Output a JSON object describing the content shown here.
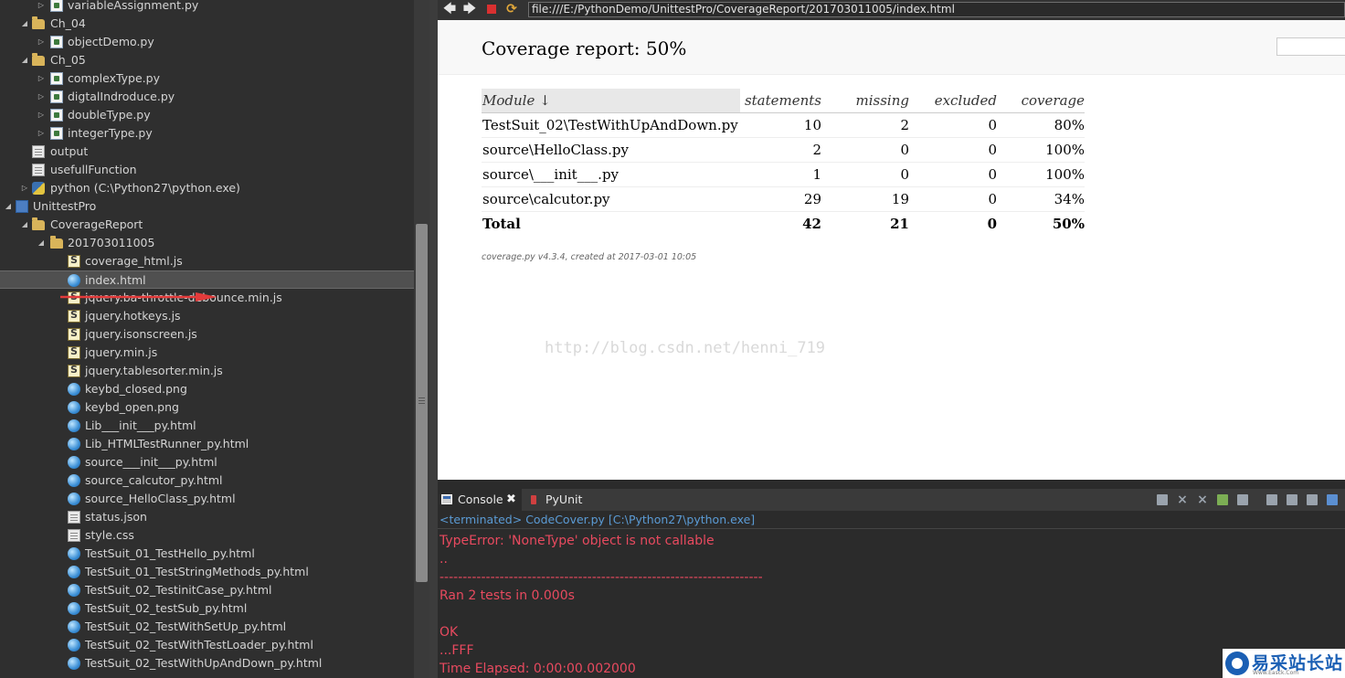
{
  "tree": [
    {
      "label": "variableAssignment.py",
      "icon": "py",
      "depth": 3,
      "arrow": "collapsed"
    },
    {
      "label": "Ch_04",
      "icon": "folder",
      "depth": 2,
      "arrow": "expanded"
    },
    {
      "label": "objectDemo.py",
      "icon": "py",
      "depth": 3,
      "arrow": "collapsed"
    },
    {
      "label": "Ch_05",
      "icon": "folder",
      "depth": 2,
      "arrow": "expanded"
    },
    {
      "label": "complexType.py",
      "icon": "py",
      "depth": 3,
      "arrow": "collapsed"
    },
    {
      "label": "digtalIndroduce.py",
      "icon": "py",
      "depth": 3,
      "arrow": "collapsed"
    },
    {
      "label": "doubleType.py",
      "icon": "py",
      "depth": 3,
      "arrow": "collapsed"
    },
    {
      "label": "integerType.py",
      "icon": "py",
      "depth": 3,
      "arrow": "collapsed"
    },
    {
      "label": "output",
      "icon": "file",
      "depth": 2,
      "arrow": "none"
    },
    {
      "label": "usefullFunction",
      "icon": "file",
      "depth": 2,
      "arrow": "none"
    },
    {
      "label": "python  (C:\\Python27\\python.exe)",
      "icon": "python",
      "depth": 2,
      "arrow": "collapsed"
    },
    {
      "label": "UnittestPro",
      "icon": "project",
      "depth": 1,
      "arrow": "expanded"
    },
    {
      "label": "CoverageReport",
      "icon": "folder",
      "depth": 2,
      "arrow": "expanded"
    },
    {
      "label": "201703011005",
      "icon": "folder",
      "depth": 3,
      "arrow": "expanded"
    },
    {
      "label": "coverage_html.js",
      "icon": "js",
      "depth": 4,
      "arrow": "none"
    },
    {
      "label": "index.html",
      "icon": "html",
      "depth": 4,
      "arrow": "none",
      "selected": true
    },
    {
      "label": "jquery.ba-throttle-debounce.min.js",
      "icon": "js",
      "depth": 4,
      "arrow": "none"
    },
    {
      "label": "jquery.hotkeys.js",
      "icon": "js",
      "depth": 4,
      "arrow": "none"
    },
    {
      "label": "jquery.isonscreen.js",
      "icon": "js",
      "depth": 4,
      "arrow": "none"
    },
    {
      "label": "jquery.min.js",
      "icon": "js",
      "depth": 4,
      "arrow": "none"
    },
    {
      "label": "jquery.tablesorter.min.js",
      "icon": "js",
      "depth": 4,
      "arrow": "none"
    },
    {
      "label": "keybd_closed.png",
      "icon": "html",
      "depth": 4,
      "arrow": "none"
    },
    {
      "label": "keybd_open.png",
      "icon": "html",
      "depth": 4,
      "arrow": "none"
    },
    {
      "label": "Lib___init___py.html",
      "icon": "html",
      "depth": 4,
      "arrow": "none"
    },
    {
      "label": "Lib_HTMLTestRunner_py.html",
      "icon": "html",
      "depth": 4,
      "arrow": "none"
    },
    {
      "label": "source___init___py.html",
      "icon": "html",
      "depth": 4,
      "arrow": "none"
    },
    {
      "label": "source_calcutor_py.html",
      "icon": "html",
      "depth": 4,
      "arrow": "none"
    },
    {
      "label": "source_HelloClass_py.html",
      "icon": "html",
      "depth": 4,
      "arrow": "none"
    },
    {
      "label": "status.json",
      "icon": "file",
      "depth": 4,
      "arrow": "none"
    },
    {
      "label": "style.css",
      "icon": "file",
      "depth": 4,
      "arrow": "none"
    },
    {
      "label": "TestSuit_01_TestHello_py.html",
      "icon": "html",
      "depth": 4,
      "arrow": "none"
    },
    {
      "label": "TestSuit_01_TestStringMethods_py.html",
      "icon": "html",
      "depth": 4,
      "arrow": "none"
    },
    {
      "label": "TestSuit_02_TestinitCase_py.html",
      "icon": "html",
      "depth": 4,
      "arrow": "none"
    },
    {
      "label": "TestSuit_02_testSub_py.html",
      "icon": "html",
      "depth": 4,
      "arrow": "none"
    },
    {
      "label": "TestSuit_02_TestWithSetUp_py.html",
      "icon": "html",
      "depth": 4,
      "arrow": "none"
    },
    {
      "label": "TestSuit_02_TestWithTestLoader_py.html",
      "icon": "html",
      "depth": 4,
      "arrow": "none"
    },
    {
      "label": "TestSuit_02_TestWithUpAndDown_py.html",
      "icon": "html",
      "depth": 4,
      "arrow": "none"
    }
  ],
  "browser": {
    "address": "file:///E:/PythonDemo/UnittestPro/CoverageReport/201703011005/index.html",
    "back_glyph": "🡄",
    "forward_glyph": "🡆",
    "refresh_glyph": "⟳"
  },
  "report": {
    "title": "Coverage report: 50%",
    "columns": {
      "module": "Module ↓",
      "statements": "statements",
      "missing": "missing",
      "excluded": "excluded",
      "coverage": "coverage"
    },
    "rows": [
      {
        "module": "TestSuit_02\\TestWithUpAndDown.py",
        "statements": "10",
        "missing": "2",
        "excluded": "0",
        "coverage": "80%"
      },
      {
        "module": "source\\HelloClass.py",
        "statements": "2",
        "missing": "0",
        "excluded": "0",
        "coverage": "100%"
      },
      {
        "module": "source\\___init___.py",
        "statements": "1",
        "missing": "0",
        "excluded": "0",
        "coverage": "100%"
      },
      {
        "module": "source\\calcutor.py",
        "statements": "29",
        "missing": "19",
        "excluded": "0",
        "coverage": "34%"
      }
    ],
    "total": {
      "module": "Total",
      "statements": "42",
      "missing": "21",
      "excluded": "0",
      "coverage": "50%"
    },
    "footer": "coverage.py v4.3.4, created at 2017-03-01 10:05",
    "watermark": "http://blog.csdn.net/henni_719"
  },
  "console": {
    "tab_label": "Console",
    "close_glyph": "✖",
    "pyunit_label": "PyUnit",
    "status": "<terminated> CodeCover.py [C:\\Python27\\python.exe]",
    "lines": [
      "TypeError: 'NoneType' object is not callable",
      "..",
      "----------------------------------------------------------------------",
      "Ran 2 tests in 0.000s",
      "",
      "OK",
      "...FFF",
      "Time Elapsed: 0:00:00.002000"
    ]
  },
  "logo": {
    "text": "易采站长站",
    "sub": "Www.Easck.Com"
  },
  "colors": {
    "console_text": "#e84a5f",
    "status_text": "#5b9bd5",
    "annotation_arrow": "#e33b3b"
  }
}
